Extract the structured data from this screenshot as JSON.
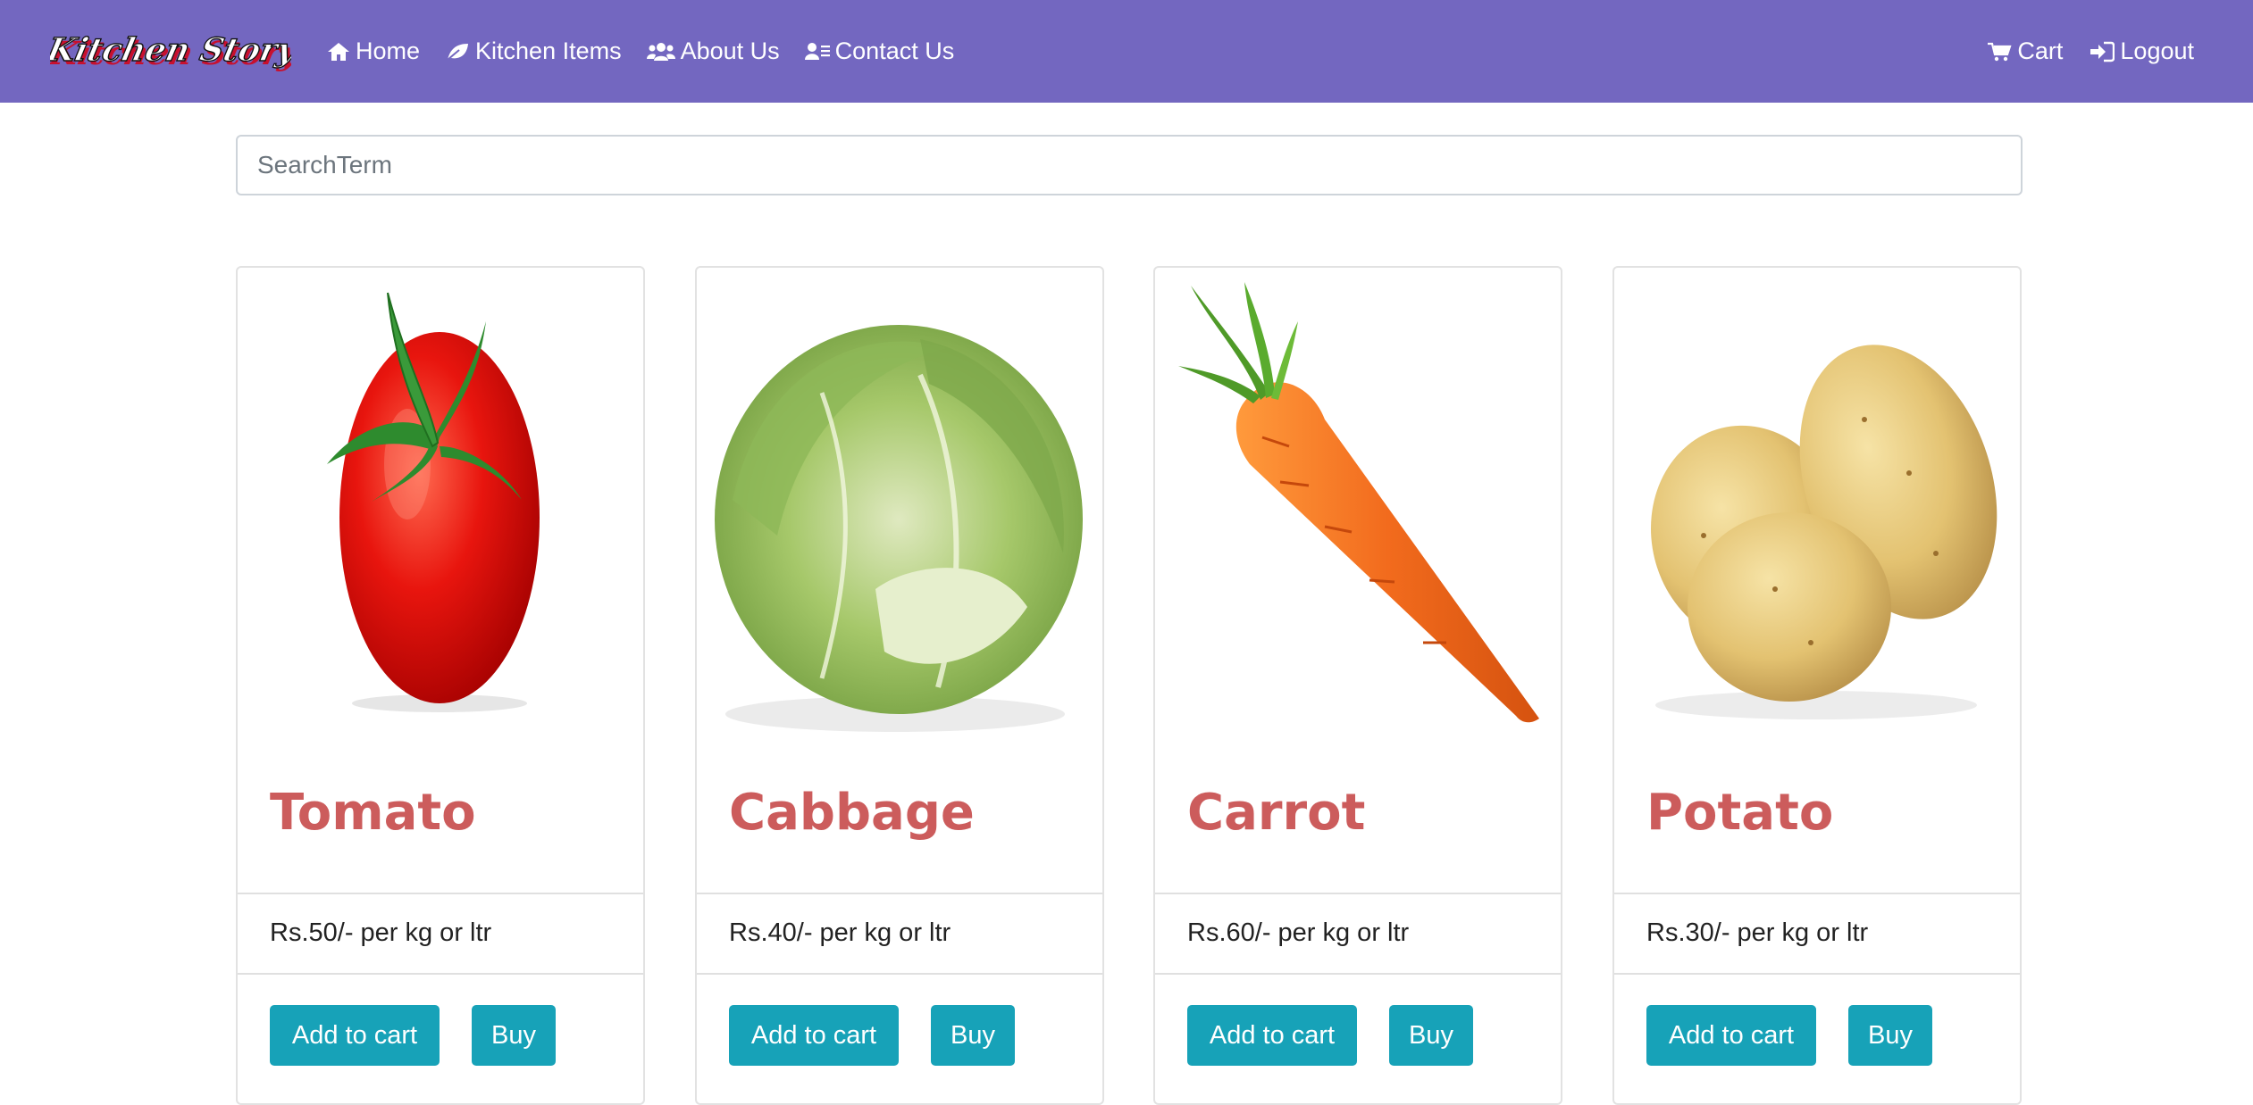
{
  "brand": {
    "logo_text": "Kitchen Story"
  },
  "nav": {
    "home": "Home",
    "kitchen_items": "Kitchen Items",
    "about": "About Us",
    "contact": "Contact Us",
    "cart": "Cart",
    "logout": "Logout"
  },
  "search": {
    "placeholder": "SearchTerm"
  },
  "products": [
    {
      "name": "Tomato",
      "price": "Rs.50/- per kg or ltr",
      "add_label": "Add to cart",
      "buy_label": "Buy",
      "image": "tomato"
    },
    {
      "name": "Cabbage",
      "price": "Rs.40/- per kg or ltr",
      "add_label": "Add to cart",
      "buy_label": "Buy",
      "image": "cabbage"
    },
    {
      "name": "Carrot",
      "price": "Rs.60/- per kg or ltr",
      "add_label": "Add to cart",
      "buy_label": "Buy",
      "image": "carrot"
    },
    {
      "name": "Potato",
      "price": "Rs.30/- per kg or ltr",
      "add_label": "Add to cart",
      "buy_label": "Buy",
      "image": "potato"
    }
  ],
  "colors": {
    "navbar": "#7367c0",
    "title": "#cc5c5c",
    "button": "#17a2b8"
  }
}
